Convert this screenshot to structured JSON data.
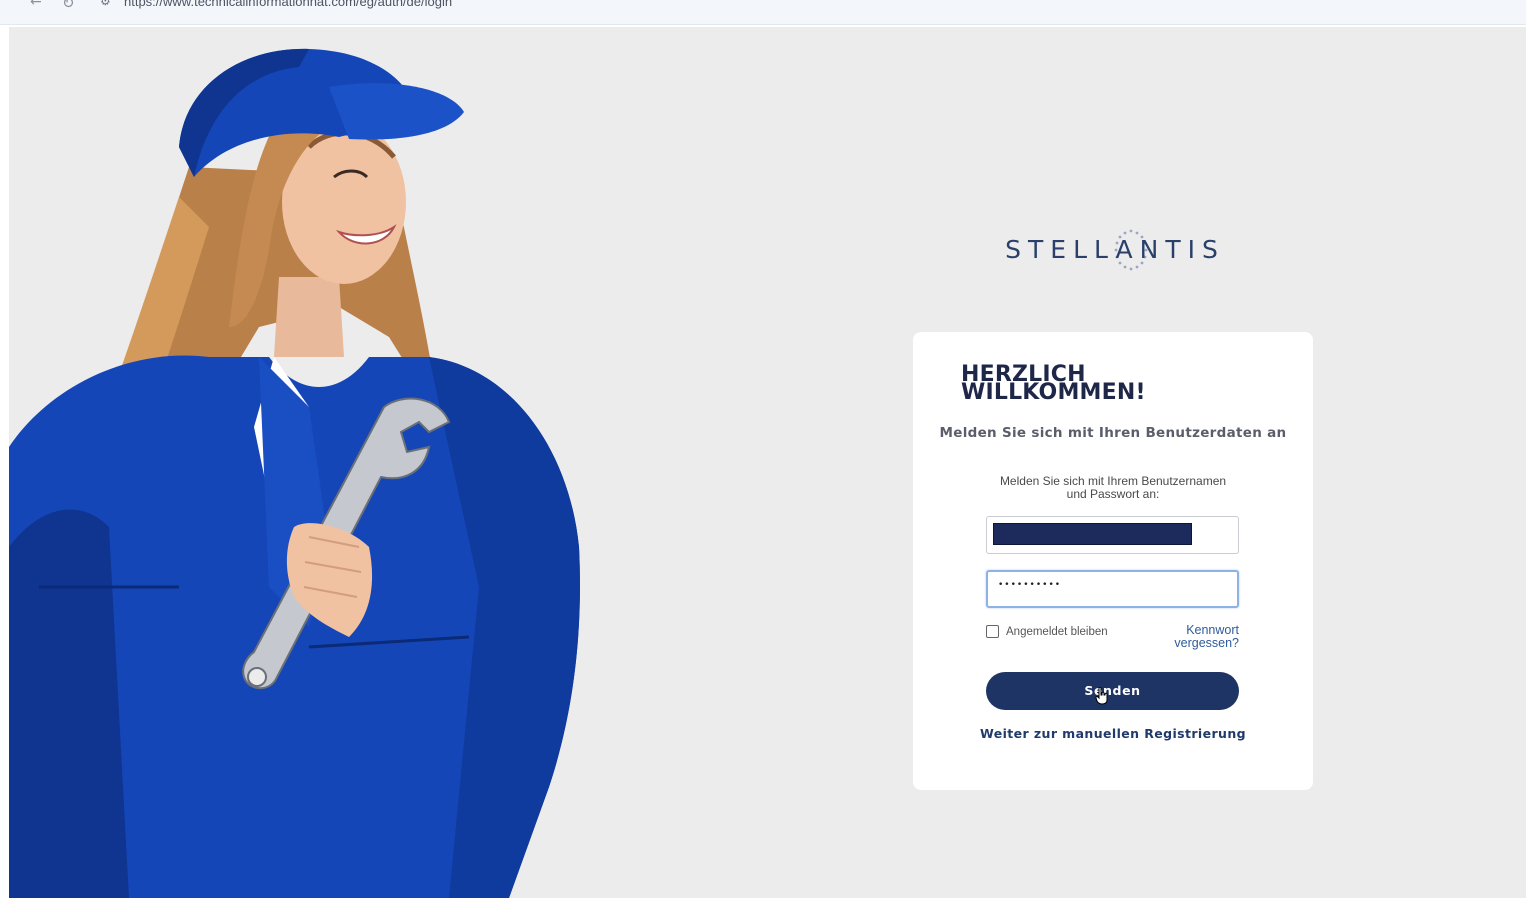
{
  "browser": {
    "url": "https://www.technicalinformationnat.com/eg/auth/de/login"
  },
  "brand": {
    "logo_text": "STELLANTIS",
    "accent_color": "#1e3465",
    "logo_color": "#2b3f6b"
  },
  "login": {
    "welcome_line1": "HERZLICH",
    "welcome_line2": "WILLKOMMEN!",
    "subtitle": "Melden Sie sich mit Ihren Benutzerdaten an",
    "instruction_line1": "Melden Sie sich mit Ihrem Benutzernamen",
    "instruction_line2": "und Passwort an:",
    "password_value": "••••••••••",
    "remember_label": "Angemeldet bleiben",
    "forgot_line1": "Kennwort",
    "forgot_line2": "vergessen?",
    "submit_label": "Senden",
    "register_link": "Weiter zur manuellen Registrierung"
  },
  "icons": {
    "back": "arrow-left-icon",
    "reload": "reload-icon",
    "site_info": "site-info-icon",
    "cursor": "hand-pointer-icon"
  }
}
